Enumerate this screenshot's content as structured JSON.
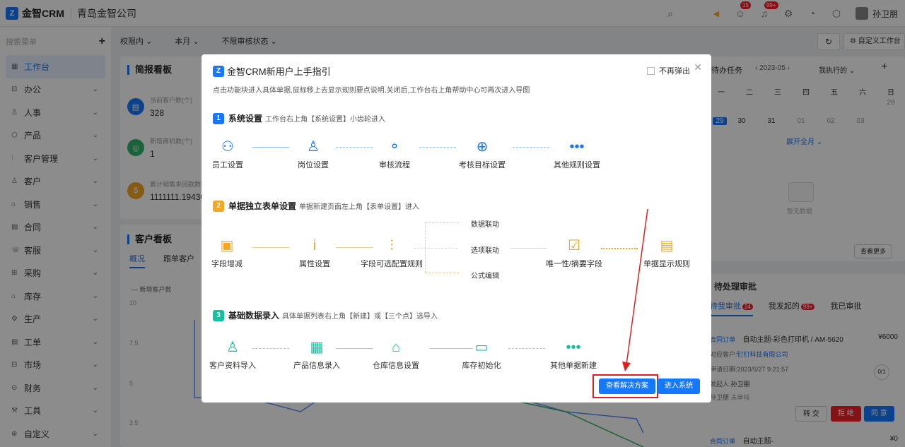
{
  "header": {
    "logo_text": "金智CRM",
    "company": "青岛金智公司",
    "user": "孙卫朋",
    "badge_msg": "15",
    "badge_notice": "99+"
  },
  "sidebar": {
    "search_placeholder": "搜索菜单",
    "items": [
      {
        "label": "工作台",
        "active": true
      },
      {
        "label": "办公"
      },
      {
        "label": "人事"
      },
      {
        "label": "产品"
      },
      {
        "label": "客户管理"
      },
      {
        "label": "客户"
      },
      {
        "label": "销售"
      },
      {
        "label": "合同"
      },
      {
        "label": "客服"
      },
      {
        "label": "采购"
      },
      {
        "label": "库存"
      },
      {
        "label": "生产"
      },
      {
        "label": "工单"
      },
      {
        "label": "市场"
      },
      {
        "label": "财务"
      },
      {
        "label": "工具"
      },
      {
        "label": "自定义"
      }
    ]
  },
  "filters": [
    "权限内",
    "本月",
    "不限审核状态"
  ],
  "top_actions": {
    "custom": "自定义工作台"
  },
  "brief": {
    "title": "简报看板",
    "stats": [
      {
        "label": "当前客户数(个)",
        "value": "328"
      },
      {
        "label": "新增商机数(个)",
        "value": "1"
      },
      {
        "label": "累计销售未回款数(元)",
        "value": "1111111.194302"
      }
    ]
  },
  "customer": {
    "title": "客户看板",
    "tabs": [
      "概况",
      "跟单客户"
    ],
    "legend": "新增客户数",
    "yticks": [
      "10",
      "7.5",
      "5",
      "2.5"
    ]
  },
  "tasks": {
    "title": "待办任务",
    "month": "2023-05",
    "scope": "我执行的",
    "weekdays": [
      "一",
      "二",
      "三",
      "四",
      "五",
      "六",
      "日"
    ],
    "row1": [
      "",
      "",
      "",
      "",
      "",
      "",
      "28"
    ],
    "row2": [
      "29",
      "30",
      "31",
      "01",
      "02",
      "03",
      ""
    ],
    "expand": "展开全月",
    "empty": "暂无数据",
    "more": "查看更多"
  },
  "approval": {
    "title": "待处理审批",
    "tabs": [
      {
        "label": "待我审批",
        "count": "24"
      },
      {
        "label": "我发起的",
        "count": "99+"
      },
      {
        "label": "我已审批",
        "count": ""
      }
    ],
    "item": {
      "tag": "合同订单",
      "subject": "自动主题-彩色打印机 / AM-5620",
      "amount": "¥6000",
      "cust_label": "对应客户:",
      "customer": "钉钉科技有限公司",
      "date_label": "申请日期:",
      "date": "2023/5/27 9:21:57",
      "steps": "0/1",
      "sponsor_label": "发起人:",
      "sponsor": "孙卫朋",
      "approver": "孙卫朋",
      "status": "未审核"
    },
    "buttons": [
      "转 交",
      "拒 绝",
      "同 意"
    ],
    "item2_tag": "合同订单",
    "item2_subject": "自动主题-",
    "item2_amount": "¥0"
  },
  "modal": {
    "title": "金智CRM新用户上手指引",
    "no_more": "不再弹出",
    "desc": "点击功能块进入具体单据,鼠标移上去显示规则要点说明,关闭后,工作台右上角帮助中心可再次进入导图",
    "sections": [
      {
        "num": "1",
        "title": "系统设置",
        "sub": "工作台右上角【系统设置】小齿轮进入",
        "nodes": [
          "员工设置",
          "岗位设置",
          "审核流程",
          "考核目标设置",
          "其他规则设置"
        ]
      },
      {
        "num": "2",
        "title": "单据独立表单设置",
        "sub": "单据新建页面左上角【表单设置】进入",
        "nodes": [
          "字段增减",
          "属性设置",
          "字段可选配置规则",
          "唯一性/摘要字段",
          "单据显示规则"
        ],
        "branches": [
          "数据联动",
          "选项联动",
          "公式编辑"
        ]
      },
      {
        "num": "3",
        "title": "基础数据录入",
        "sub": "具体单据列表右上角【新建】或【三个点】选导入",
        "nodes": [
          "客户资料导入",
          "产品信息录入",
          "仓库信息设置",
          "库存初始化",
          "其他单据新建"
        ]
      }
    ],
    "btn_solution": "查看解决方案",
    "btn_enter": "进入系统"
  },
  "colors": {
    "primary": "#1677ff",
    "step1": "#1677ff",
    "step2": "#f5a623",
    "step3": "#13c2a3",
    "highlight": "#e02020"
  }
}
